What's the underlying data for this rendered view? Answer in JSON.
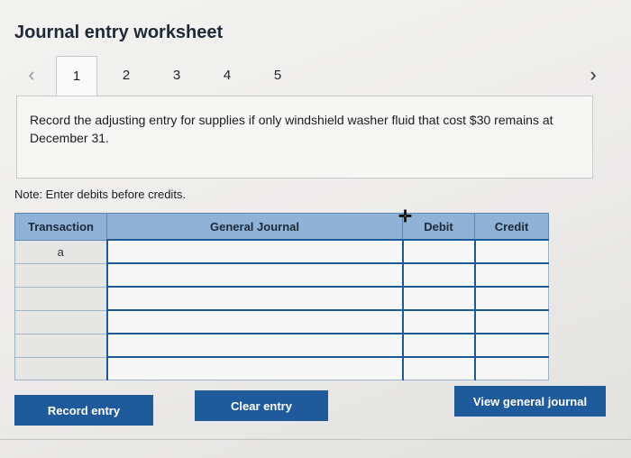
{
  "title": "Journal entry worksheet",
  "tabs": {
    "prev_icon": "‹",
    "next_icon": "›",
    "items": [
      "1",
      "2",
      "3",
      "4",
      "5"
    ],
    "active": "1"
  },
  "question": "Record the adjusting entry for supplies if only windshield washer fluid that cost $30 remains at December 31.",
  "note": "Note: Enter debits before credits.",
  "journal": {
    "headers": {
      "transaction": "Transaction",
      "general_journal": "General Journal",
      "debit": "Debit",
      "credit": "Credit"
    },
    "rows": [
      {
        "transaction": "a",
        "general_journal": "",
        "debit": "",
        "credit": ""
      },
      {
        "transaction": "",
        "general_journal": "",
        "debit": "",
        "credit": ""
      },
      {
        "transaction": "",
        "general_journal": "",
        "debit": "",
        "credit": ""
      },
      {
        "transaction": "",
        "general_journal": "",
        "debit": "",
        "credit": ""
      },
      {
        "transaction": "",
        "general_journal": "",
        "debit": "",
        "credit": ""
      },
      {
        "transaction": "",
        "general_journal": "",
        "debit": "",
        "credit": ""
      }
    ]
  },
  "buttons": {
    "record": "Record entry",
    "clear": "Clear entry",
    "view": "View general journal"
  },
  "colors": {
    "accent": "#1f5b9a",
    "header_bg": "#8fb2d6"
  }
}
